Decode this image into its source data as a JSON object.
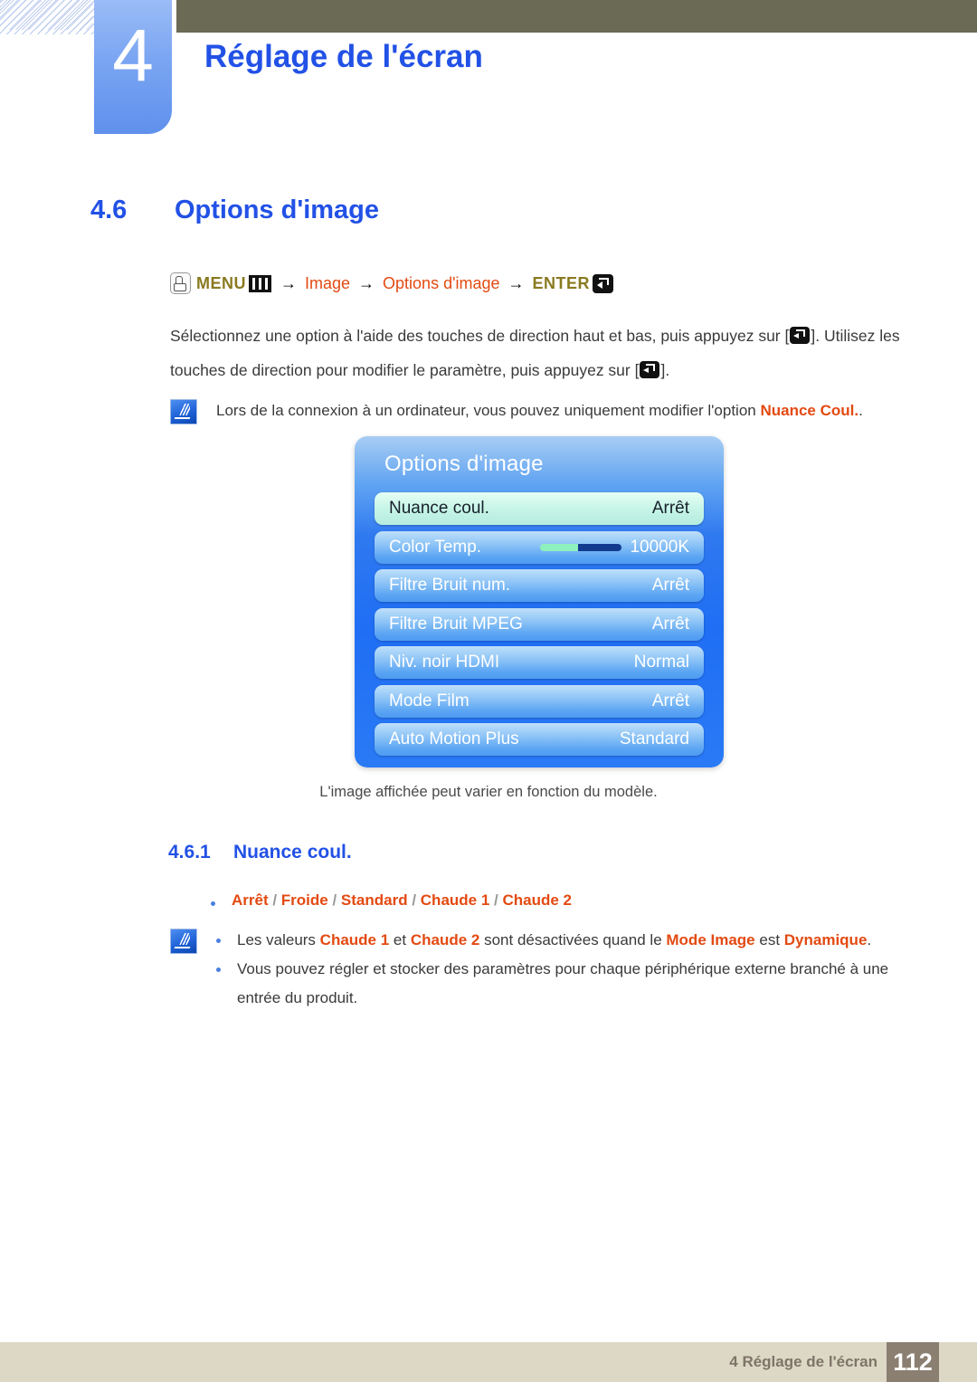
{
  "header": {
    "chapter_number": "4",
    "chapter_title": "Réglage de l'écran"
  },
  "section": {
    "number": "4.6",
    "title": "Options d'image"
  },
  "nav_path": {
    "button_icon": "finger-press-icon",
    "menu_label": "MENU",
    "menu_icon": "menu-bars-icon",
    "arrow1": "→",
    "step1": "Image",
    "arrow2": "→",
    "step2": "Options d'image",
    "arrow3": "→",
    "enter_label": "ENTER",
    "enter_icon": "enter-key-icon"
  },
  "intro": {
    "text_part1": "Sélectionnez une option à l'aide des touches de direction haut et bas, puis appuyez sur [",
    "text_part2": "]. Utilisez les touches de direction pour modifier le paramètre, puis appuyez sur [",
    "text_part3": "]."
  },
  "note_top": {
    "icon": "note-pen-icon",
    "text_before": "Lors de la connexion à un ordinateur, vous pouvez uniquement modifier l'option ",
    "highlight": "Nuance Coul.",
    "text_after": "."
  },
  "osd": {
    "title": "Options d'image",
    "rows": [
      {
        "label": "Nuance coul.",
        "value": "Arrêt",
        "selected": true,
        "has_slider": false
      },
      {
        "label": "Color Temp.",
        "value": "10000K",
        "selected": false,
        "has_slider": true
      },
      {
        "label": "Filtre Bruit num.",
        "value": "Arrêt",
        "selected": false,
        "has_slider": false
      },
      {
        "label": "Filtre Bruit MPEG",
        "value": "Arrêt",
        "selected": false,
        "has_slider": false
      },
      {
        "label": "Niv. noir HDMI",
        "value": "Normal",
        "selected": false,
        "has_slider": false
      },
      {
        "label": "Mode Film",
        "value": "Arrêt",
        "selected": false,
        "has_slider": false
      },
      {
        "label": "Auto Motion Plus",
        "value": "Standard",
        "selected": false,
        "has_slider": false
      }
    ],
    "caption": "L'image affichée peut varier en fonction du modèle."
  },
  "subsection": {
    "number": "4.6.1",
    "title": "Nuance coul."
  },
  "options_line": {
    "items": [
      "Arrêt",
      "Froide",
      "Standard",
      "Chaude 1",
      "Chaude 2"
    ],
    "separator": " / "
  },
  "note_bottom": {
    "icon": "note-pen-icon",
    "bullets": [
      {
        "segments": [
          {
            "text": "Les valeurs ",
            "highlight": false
          },
          {
            "text": "Chaude 1",
            "highlight": true
          },
          {
            "text": " et ",
            "highlight": false
          },
          {
            "text": "Chaude 2",
            "highlight": true
          },
          {
            "text": " sont désactivées quand le ",
            "highlight": false
          },
          {
            "text": "Mode Image",
            "highlight": true
          },
          {
            "text": " est ",
            "highlight": false
          },
          {
            "text": "Dynamique",
            "highlight": true
          },
          {
            "text": ".",
            "highlight": false
          }
        ]
      },
      {
        "segments": [
          {
            "text": "Vous pouvez régler et stocker des paramètres pour chaque périphérique externe branché à une entrée du produit.",
            "highlight": false
          }
        ]
      }
    ]
  },
  "footer": {
    "text": "4 Réglage de l'écran",
    "page": "112"
  },
  "colors": {
    "accent_blue": "#2251e6",
    "orange": "#e34a12",
    "olive": "#6b6a54",
    "footer_bg": "#ddd7c6",
    "page_box": "#8b7f72",
    "menu_gold": "#8a7a20"
  }
}
